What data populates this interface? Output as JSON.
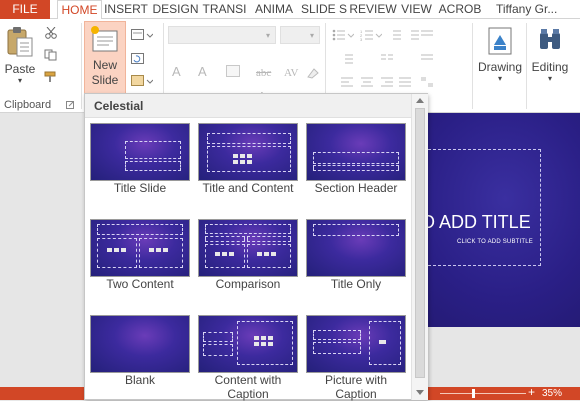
{
  "tabs": {
    "file": "FILE",
    "home": "HOME",
    "insert": "INSERT",
    "design": "DESIGN",
    "transitions": "TRANSI",
    "animations": "ANIMA",
    "slideshow": "SLIDE S",
    "review": "REVIEW",
    "view": "VIEW",
    "acrobat": "ACROB",
    "user": "Tiffany Gr..."
  },
  "ribbon": {
    "paste_label": "Paste",
    "new_slide_line1": "New",
    "new_slide_line2": "Slide",
    "clipboard_group": "Clipboard",
    "drawing_label": "Drawing",
    "editing_label": "Editing"
  },
  "gallery": {
    "theme_name": "Celestial",
    "layouts": [
      {
        "line1": "Title Slide",
        "line2": ""
      },
      {
        "line1": "Title and Content",
        "line2": ""
      },
      {
        "line1": "Section Header",
        "line2": ""
      },
      {
        "line1": "Two Content",
        "line2": ""
      },
      {
        "line1": "Comparison",
        "line2": ""
      },
      {
        "line1": "Title Only",
        "line2": ""
      },
      {
        "line1": "Blank",
        "line2": ""
      },
      {
        "line1": "Content with",
        "line2": "Caption"
      },
      {
        "line1": "Picture with",
        "line2": "Caption"
      }
    ]
  },
  "slide": {
    "title": "O ADD TITLE",
    "subtitle": "CLICK TO ADD SUBTITLE"
  },
  "statusbar": {
    "zoom": "35%",
    "zoom_plus": "+"
  },
  "colors": {
    "accent": "#d24726",
    "slide_bg": "#2a1f86"
  }
}
